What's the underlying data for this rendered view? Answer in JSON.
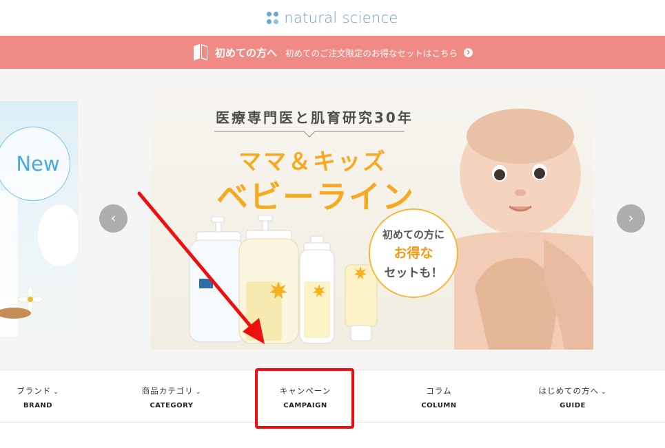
{
  "header": {
    "logo_text": "natural science"
  },
  "banner": {
    "strong": "初めての方へ",
    "sub": "初めてのご注文限定のお得なセットはこちら"
  },
  "hero": {
    "left_slide": {
      "badge": "New"
    },
    "main_slide": {
      "tagline": "医療専門医と肌育研究30年",
      "title_line1": "ママ＆キッズ",
      "title_line2": "ベビーライン",
      "bubble": {
        "line1": "初めての方に",
        "line2": "お得な",
        "line3": "セットも！"
      }
    },
    "prev_label": "‹",
    "next_label": "›"
  },
  "nav": {
    "items": [
      {
        "jp": "ブランド",
        "en": "BRAND",
        "dropdown": true
      },
      {
        "jp": "商品カテゴリ",
        "en": "CATEGORY",
        "dropdown": true
      },
      {
        "jp": "キャンペーン",
        "en": "CAMPAIGN",
        "dropdown": false
      },
      {
        "jp": "コラム",
        "en": "COLUMN",
        "dropdown": false
      },
      {
        "jp": "はじめての方へ",
        "en": "GUIDE",
        "dropdown": true
      }
    ]
  },
  "colors": {
    "banner_bg": "#f08a85",
    "logo": "#6c9fc9",
    "slide_accent": "#f5aa22",
    "annotation": "#ee1010"
  }
}
